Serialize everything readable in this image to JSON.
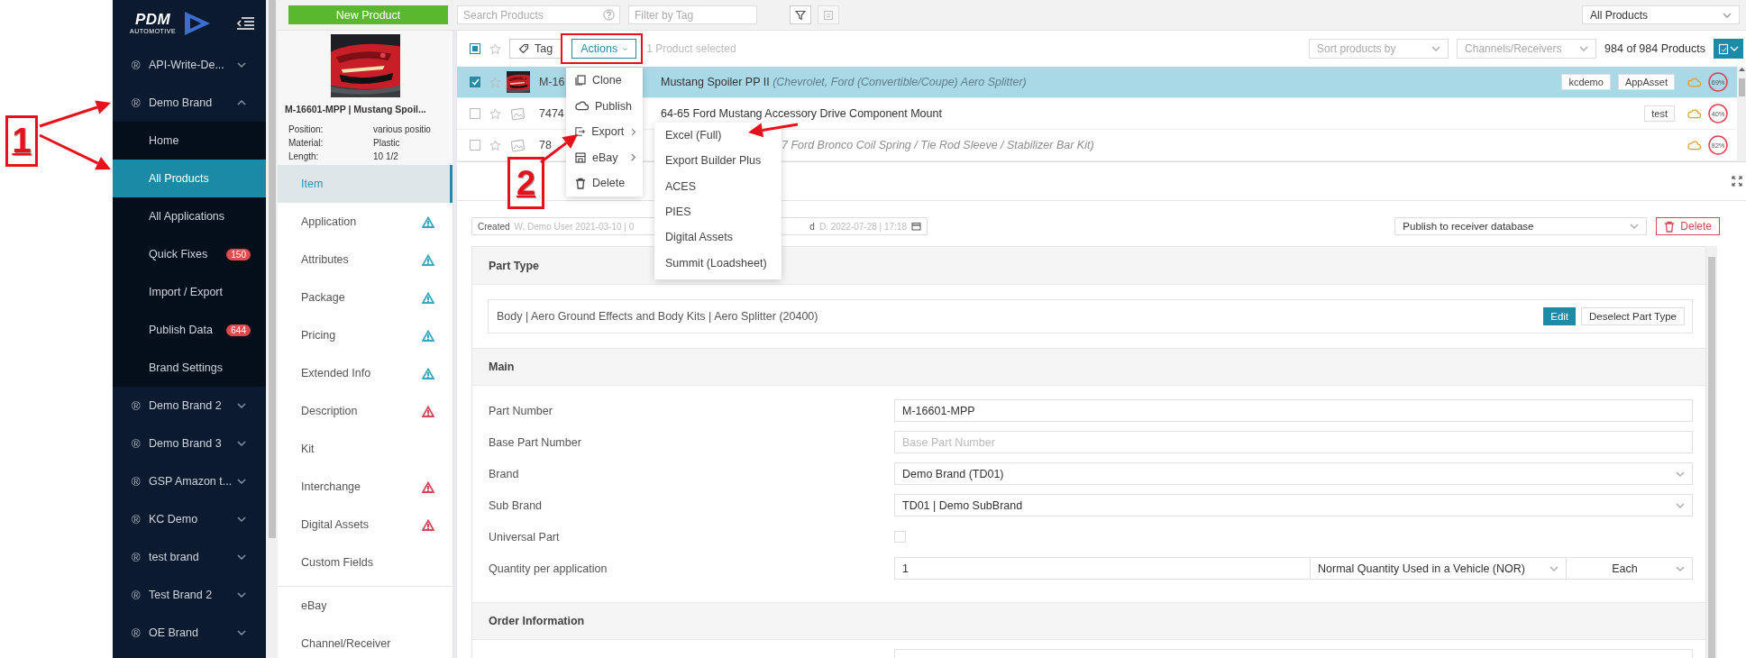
{
  "callouts": [
    {
      "label": "1"
    },
    {
      "label": "2"
    }
  ],
  "sidebar": {
    "logo": {
      "text": "PDM",
      "subtext": "AUTOMOTIVE"
    },
    "brands": [
      {
        "icon": "®",
        "label": "API-Write-De...",
        "expanded": false
      },
      {
        "icon": "®",
        "label": "Demo Brand",
        "expanded": true,
        "children": [
          {
            "label": "Home",
            "selected": false
          },
          {
            "label": "All Products",
            "selected": true
          },
          {
            "label": "All Applications",
            "selected": false
          },
          {
            "label": "Quick Fixes",
            "selected": false,
            "badge": "150"
          },
          {
            "label": "Import / Export",
            "selected": false
          },
          {
            "label": "Publish Data",
            "selected": false,
            "badge": "644"
          },
          {
            "label": "Brand Settings",
            "selected": false
          }
        ]
      },
      {
        "icon": "®",
        "label": "Demo Brand 2",
        "expanded": false
      },
      {
        "icon": "®",
        "label": "Demo Brand 3",
        "expanded": false
      },
      {
        "icon": "®",
        "label": "GSP Amazon t...",
        "expanded": false
      },
      {
        "icon": "®",
        "label": "KC Demo",
        "expanded": false
      },
      {
        "icon": "®",
        "label": "test brand",
        "expanded": false
      },
      {
        "icon": "®",
        "label": "Test Brand 2",
        "expanded": false
      },
      {
        "icon": "®",
        "label": "OE Brand",
        "expanded": false
      }
    ]
  },
  "toolbar": {
    "new_button": "New Product",
    "search": {
      "placeholder": "Search Products"
    },
    "tag_filter": {
      "placeholder": "Filter by Tag"
    },
    "icon_button": {
      "disabled": true
    },
    "view_select": "All Products"
  },
  "summary": {
    "title": "M-16601-MPP | Mustang Spoil...",
    "specs": [
      {
        "label": "Position:",
        "value": "various positio"
      },
      {
        "label": "Material:",
        "value": "Plastic"
      },
      {
        "label": "Length:",
        "value": "10 1/2"
      }
    ]
  },
  "nav": {
    "items": [
      {
        "label": "Item",
        "selected": true
      },
      {
        "label": "Application",
        "selected": false,
        "color": "#3aa8bd"
      },
      {
        "label": "Attributes",
        "selected": false,
        "color": "#3aa8bd"
      },
      {
        "label": "Package",
        "selected": false,
        "color": "#3aa8bd"
      },
      {
        "label": "Pricing",
        "selected": false,
        "color": "#3aa8bd"
      },
      {
        "label": "Extended Info",
        "selected": false,
        "color": "#3aa8bd"
      },
      {
        "label": "Description",
        "selected": false,
        "color": "#d9475a"
      },
      {
        "label": "Kit",
        "selected": false
      },
      {
        "label": "Interchange",
        "selected": false,
        "color": "#d9475a"
      },
      {
        "label": "Digital Assets",
        "selected": false,
        "color": "#d9475a"
      },
      {
        "label": "Custom Fields",
        "selected": false
      }
    ],
    "extra_items": [
      {
        "label": "eBay",
        "selected": false
      },
      {
        "label": "Channel/Receiver",
        "selected": false
      }
    ]
  },
  "list": {
    "select_all": {
      "checked": true
    },
    "tag_button": "Tag",
    "actions_button": "Actions",
    "selection_info": "1 Product selected",
    "sort": {
      "placeholder": "Sort products by"
    },
    "channels": {
      "placeholder": "Channels/Receivers"
    },
    "count": "984 of 984 Products",
    "rows": [
      {
        "selected": true,
        "checked": true,
        "thumbnail": true,
        "part": "M-16",
        "name": "Mustang Spoiler PP II",
        "detail": "(Chevrolet, Ford (Convertible/Coupe) Aero Splitter)",
        "tags": [
          "kcdemo",
          "AppAsset"
        ],
        "score": "69%"
      },
      {
        "selected": false,
        "checked": false,
        "thumbnail": false,
        "part": "7474",
        "name": "64-65 Ford Mustang Accessory Drive Component Mount",
        "tags": [
          "test"
        ],
        "score": "40%"
      },
      {
        "selected": false,
        "checked": false,
        "thumbnail": false,
        "part": "78",
        "detail": "7 Ford Bronco Coil Spring / Tie Rod Sleeve / Stabilizer Bar Kit)",
        "clipped": true,
        "score": "92%"
      }
    ]
  },
  "actions_menu": {
    "items": [
      {
        "label": "Clone",
        "kind": "clone",
        "submenu": false
      },
      {
        "label": "Publish",
        "kind": "publish",
        "submenu": false
      },
      {
        "label": "Export",
        "kind": "export",
        "submenu": true
      },
      {
        "label": "eBay",
        "kind": "ebay",
        "submenu": true
      },
      {
        "label": "Delete",
        "kind": "delete",
        "submenu": false
      }
    ]
  },
  "export_menu": {
    "items": [
      "Excel (Full)",
      "Export Builder Plus",
      "ACES",
      "PIES",
      "Digital Assets",
      "Summit (Loadsheet)"
    ]
  },
  "record": {
    "created": {
      "label": "Created",
      "value": "W. Demo User 2021-03-10 | 0"
    },
    "updated": {
      "label": "d",
      "value": "D. 2022-07-28 | 17:18"
    },
    "publish_select": "Publish to receiver database",
    "delete_button": "Delete"
  },
  "form": {
    "part_type": {
      "title": "Part Type",
      "value": "Body | Aero Ground Effects and Body Kits | Aero Splitter (20400)",
      "edit_button": "Edit",
      "deselect_button": "Deselect Part Type"
    },
    "main": {
      "title": "Main",
      "rows": [
        {
          "kind": "text",
          "label": "Part Number",
          "value": "M-16601-MPP"
        },
        {
          "kind": "text",
          "label": "Base Part Number",
          "placeholder": "Base Part Number"
        },
        {
          "kind": "select",
          "label": "Brand",
          "value": "Demo Brand (TD01)"
        },
        {
          "kind": "select",
          "label": "Sub Brand",
          "value": "TD01 | Demo SubBrand"
        },
        {
          "kind": "checkbox",
          "label": "Universal Part",
          "checked": false
        },
        {
          "kind": "quantity",
          "label": "Quantity per application",
          "value": "1",
          "unit": "Normal Quantity Used in a Vehicle (NOR)",
          "uom": "Each"
        }
      ]
    },
    "order_info": {
      "title": "Order Information"
    }
  }
}
